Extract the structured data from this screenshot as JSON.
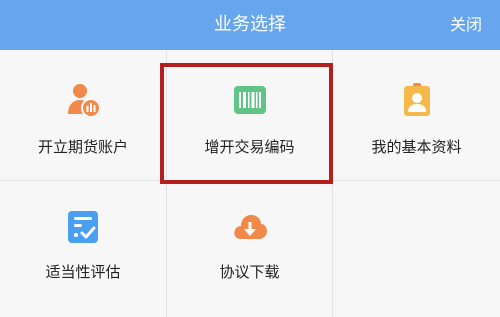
{
  "header": {
    "title": "业务选择",
    "close_label": "关闭"
  },
  "menu": {
    "items": [
      {
        "label": "开立期货账户",
        "icon": "person-chart-icon"
      },
      {
        "label": "增开交易编码",
        "icon": "barcode-icon"
      },
      {
        "label": "我的基本资料",
        "icon": "id-badge-icon"
      },
      {
        "label": "适当性评估",
        "icon": "checklist-icon"
      },
      {
        "label": "协议下载",
        "icon": "cloud-download-icon"
      }
    ],
    "selected_index": 1
  },
  "colors": {
    "header_bg": "#67a6ee",
    "highlight_border": "#b3201d",
    "orange_icon": "#f0894a",
    "green_icon": "#5fc486",
    "blue_icon": "#4b9ff0"
  }
}
